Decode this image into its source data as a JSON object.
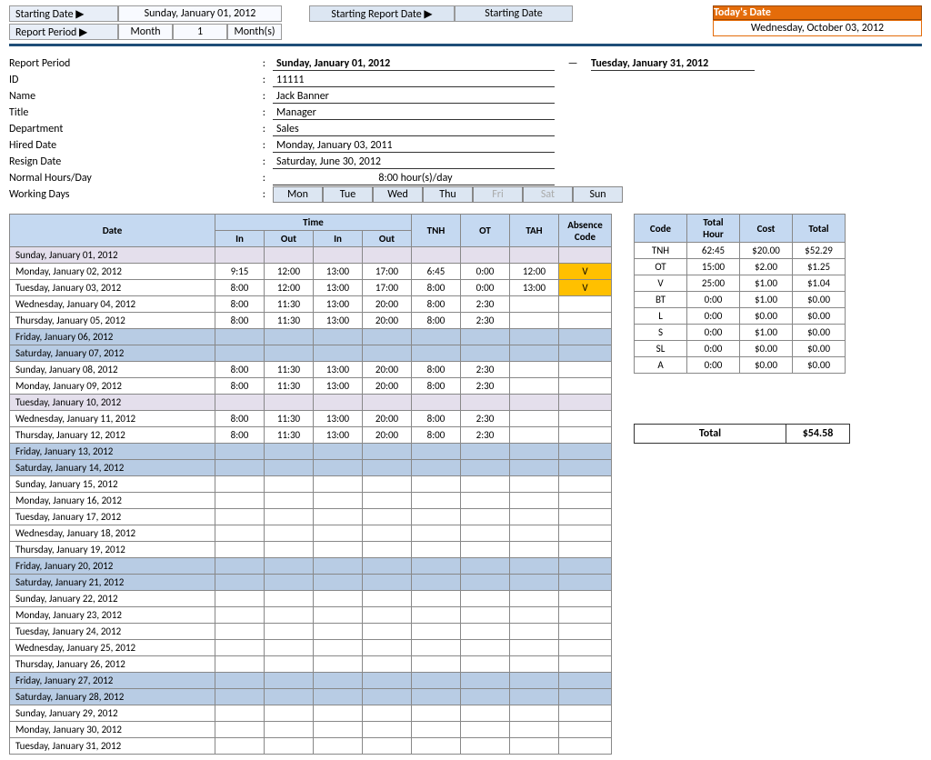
{
  "top": {
    "starting_date_lbl": "Starting Date ▶",
    "starting_date_val": "Sunday, January 01, 2012",
    "report_period_lbl": "Report Period ▶",
    "rp_unit": "Month",
    "rp_num": "1",
    "rp_suffix": "Month(s)",
    "srd_lbl": "Starting Report Date ▶",
    "srd_val": "Starting Date",
    "today_lbl": "Today's Date",
    "today_val": "Wednesday, October 03, 2012"
  },
  "info": {
    "report_period_lbl": "Report Period",
    "report_from": "Sunday, January 01, 2012",
    "report_to": "Tuesday, January 31, 2012",
    "id_lbl": "ID",
    "id_val": "11111",
    "name_lbl": "Name",
    "name_val": "Jack Banner",
    "title_lbl": "Title",
    "title_val": "Manager",
    "dept_lbl": "Department",
    "dept_val": "Sales",
    "hired_lbl": "Hired Date",
    "hired_val": "Monday, January 03, 2011",
    "resign_lbl": "Resign Date",
    "resign_val": "Saturday, June 30, 2012",
    "hours_lbl": "Normal Hours/Day",
    "hours_val": "8:00    hour(s)/day",
    "wd_lbl": "Working Days",
    "days": [
      "Mon",
      "Tue",
      "Wed",
      "Thu",
      "Fri",
      "Sat",
      "Sun"
    ]
  },
  "ts": {
    "h_date": "Date",
    "h_time": "Time",
    "h_in": "In",
    "h_out": "Out",
    "h_tnh": "TNH",
    "h_ot": "OT",
    "h_tah": "TAH",
    "h_ac": "Absence Code",
    "rows": [
      {
        "cls": "pink",
        "d": "Sunday, January 01, 2012"
      },
      {
        "cls": "v",
        "d": "Monday, January 02, 2012",
        "i1": "9:15",
        "o1": "12:00",
        "i2": "13:00",
        "o2": "17:00",
        "tnh": "6:45",
        "ot": "0:00",
        "tah": "12:00",
        "ac": "V"
      },
      {
        "cls": "v",
        "d": "Tuesday, January 03, 2012",
        "i1": "8:00",
        "o1": "12:00",
        "i2": "13:00",
        "o2": "17:00",
        "tnh": "8:00",
        "ot": "0:00",
        "tah": "13:00",
        "ac": "V"
      },
      {
        "d": "Wednesday, January 04, 2012",
        "i1": "8:00",
        "o1": "11:30",
        "i2": "13:00",
        "o2": "20:00",
        "tnh": "8:00",
        "ot": "2:30"
      },
      {
        "d": "Thursday, January 05, 2012",
        "i1": "8:00",
        "o1": "11:30",
        "i2": "13:00",
        "o2": "20:00",
        "tnh": "8:00",
        "ot": "2:30"
      },
      {
        "cls": "blue",
        "d": "Friday, January 06, 2012"
      },
      {
        "cls": "blue",
        "d": "Saturday, January 07, 2012"
      },
      {
        "d": "Sunday, January 08, 2012",
        "i1": "8:00",
        "o1": "11:30",
        "i2": "13:00",
        "o2": "20:00",
        "tnh": "8:00",
        "ot": "2:30"
      },
      {
        "d": "Monday, January 09, 2012",
        "i1": "8:00",
        "o1": "11:30",
        "i2": "13:00",
        "o2": "20:00",
        "tnh": "8:00",
        "ot": "2:30"
      },
      {
        "cls": "pink",
        "d": "Tuesday, January 10, 2012"
      },
      {
        "d": "Wednesday, January 11, 2012",
        "i1": "8:00",
        "o1": "11:30",
        "i2": "13:00",
        "o2": "20:00",
        "tnh": "8:00",
        "ot": "2:30"
      },
      {
        "d": "Thursday, January 12, 2012",
        "i1": "8:00",
        "o1": "11:30",
        "i2": "13:00",
        "o2": "20:00",
        "tnh": "8:00",
        "ot": "2:30"
      },
      {
        "cls": "blue",
        "d": "Friday, January 13, 2012"
      },
      {
        "cls": "blue",
        "d": "Saturday, January 14, 2012"
      },
      {
        "d": "Sunday, January 15, 2012"
      },
      {
        "d": "Monday, January 16, 2012"
      },
      {
        "d": "Tuesday, January 17, 2012"
      },
      {
        "d": "Wednesday, January 18, 2012"
      },
      {
        "d": "Thursday, January 19, 2012"
      },
      {
        "cls": "blue",
        "d": "Friday, January 20, 2012"
      },
      {
        "cls": "blue",
        "d": "Saturday, January 21, 2012"
      },
      {
        "d": "Sunday, January 22, 2012"
      },
      {
        "d": "Monday, January 23, 2012"
      },
      {
        "d": "Tuesday, January 24, 2012"
      },
      {
        "d": "Wednesday, January 25, 2012"
      },
      {
        "d": "Thursday, January 26, 2012"
      },
      {
        "cls": "blue",
        "d": "Friday, January 27, 2012"
      },
      {
        "cls": "blue",
        "d": "Saturday, January 28, 2012"
      },
      {
        "d": "Sunday, January 29, 2012"
      },
      {
        "d": "Monday, January 30, 2012"
      },
      {
        "d": "Tuesday, January 31, 2012"
      }
    ]
  },
  "sum": {
    "h_code": "Code",
    "h_th": "Total Hour",
    "h_cost": "Cost",
    "h_total": "Total",
    "rows": [
      {
        "c": "TNH",
        "th": "62:45",
        "cost": "$20.00",
        "tot": "$52.29"
      },
      {
        "c": "OT",
        "th": "15:00",
        "cost": "$2.00",
        "tot": "$1.25"
      },
      {
        "c": "V",
        "th": "25:00",
        "cost": "$1.00",
        "tot": "$1.04"
      },
      {
        "c": "BT",
        "th": "0:00",
        "cost": "$1.00",
        "tot": "$0.00"
      },
      {
        "c": "L",
        "th": "0:00",
        "cost": "$0.00",
        "tot": "$0.00"
      },
      {
        "c": "S",
        "th": "0:00",
        "cost": "$1.00",
        "tot": "$0.00"
      },
      {
        "c": "SL",
        "th": "0:00",
        "cost": "$0.00",
        "tot": "$0.00"
      },
      {
        "c": "A",
        "th": "0:00",
        "cost": "$0.00",
        "tot": "$0.00"
      }
    ],
    "total_lbl": "Total",
    "total_val": "$54.58"
  }
}
